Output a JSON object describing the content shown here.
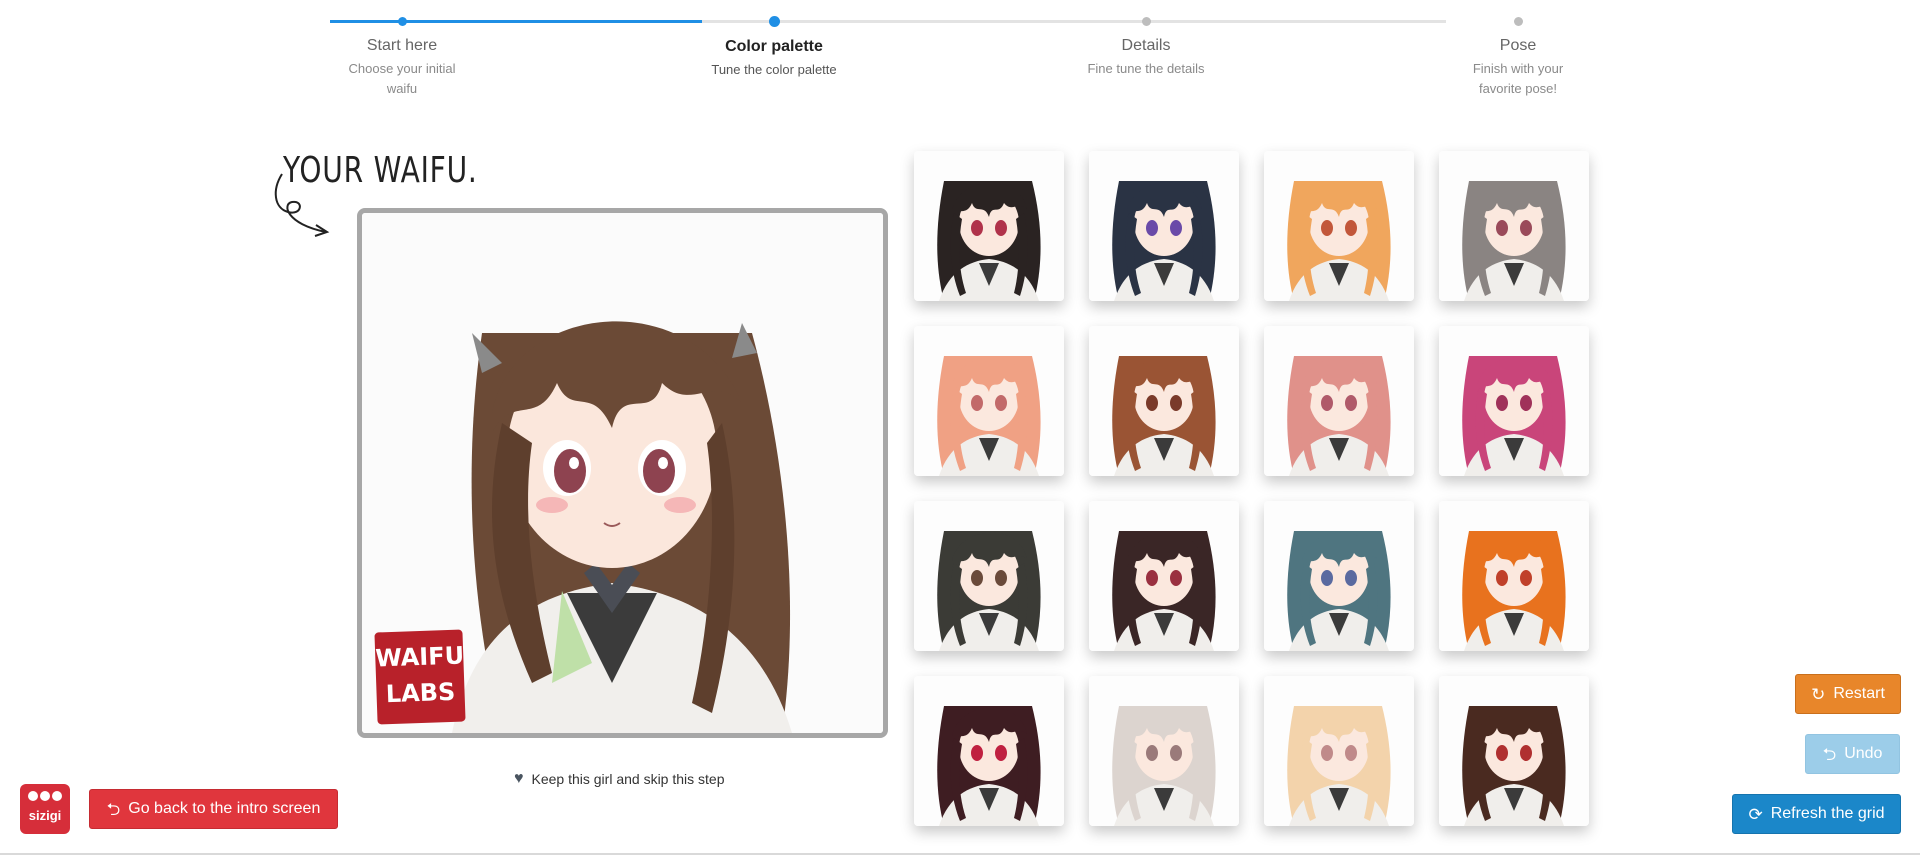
{
  "stepper": {
    "steps": [
      {
        "title": "Start here",
        "subtitle": "Choose your initial waifu",
        "state": "done"
      },
      {
        "title": "Color palette",
        "subtitle": "Tune the color palette",
        "state": "active"
      },
      {
        "title": "Details",
        "subtitle": "Fine tune the details",
        "state": "todo"
      },
      {
        "title": "Pose",
        "subtitle": "Finish with your favorite pose!",
        "state": "todo"
      }
    ],
    "accent": "#1f8fe5"
  },
  "heading": {
    "text": "YOUR WAIFU."
  },
  "main_image": {
    "icon": "waifu-portrait-image",
    "hair_color": "#6b4a36",
    "logo": {
      "line1": "WAIFU",
      "line2": "LABS",
      "color": "#b8212a"
    }
  },
  "keep_link": {
    "label": "Keep this girl and skip this step",
    "icon": "heart-icon"
  },
  "grid": {
    "tiles": [
      {
        "hair": "#2a2322",
        "eyes": "#b0324a"
      },
      {
        "hair": "#2a3344",
        "eyes": "#6a4aa8"
      },
      {
        "hair": "#f0a65d",
        "eyes": "#c2573a"
      },
      {
        "hair": "#8a8482",
        "eyes": "#9a4a5a"
      },
      {
        "hair": "#f0a184",
        "eyes": "#c26a6a"
      },
      {
        "hair": "#9a5434",
        "eyes": "#7a3a2a"
      },
      {
        "hair": "#e0918a",
        "eyes": "#b05a6a"
      },
      {
        "hair": "#c9457a",
        "eyes": "#a0325a"
      },
      {
        "hair": "#3b3b36",
        "eyes": "#6a4a3a"
      },
      {
        "hair": "#3a2626",
        "eyes": "#9a3040"
      },
      {
        "hair": "#4f7580",
        "eyes": "#5a6aa0"
      },
      {
        "hair": "#e8721e",
        "eyes": "#c0402a"
      },
      {
        "hair": "#3e1d22",
        "eyes": "#c02040"
      },
      {
        "hair": "#dcd4cf",
        "eyes": "#9a7a7a"
      },
      {
        "hair": "#f3d3ab",
        "eyes": "#c08a8a"
      },
      {
        "hair": "#4a2a20",
        "eyes": "#b03030"
      }
    ]
  },
  "buttons": {
    "back": "Go back to the intro screen",
    "restart": "Restart",
    "undo": "Undo",
    "refresh": "Refresh the grid"
  },
  "brand": {
    "name": "sizigi"
  }
}
